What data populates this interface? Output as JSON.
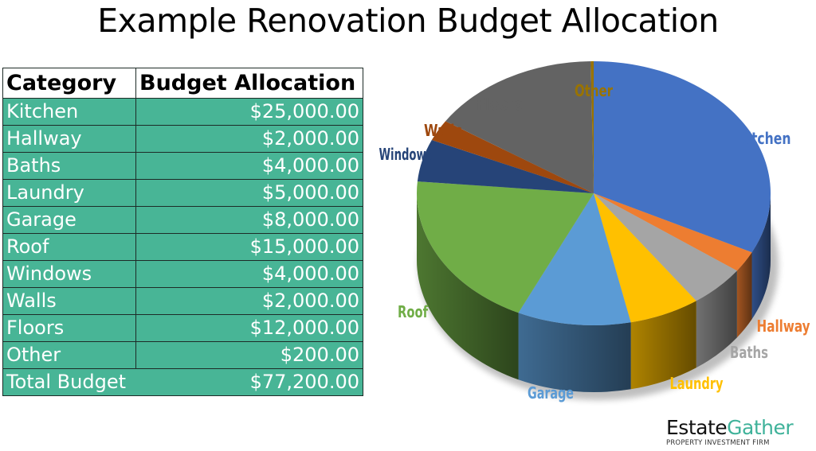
{
  "title": "Example Renovation Budget Allocation",
  "table": {
    "headers": [
      "Category",
      "Budget Allocation"
    ],
    "rows": [
      {
        "category": "Kitchen",
        "value": "$25,000.00"
      },
      {
        "category": "Hallway",
        "value": "$2,000.00"
      },
      {
        "category": "Baths",
        "value": "$4,000.00"
      },
      {
        "category": "Laundry",
        "value": "$5,000.00"
      },
      {
        "category": "Garage",
        "value": "$8,000.00"
      },
      {
        "category": "Roof",
        "value": "$15,000.00"
      },
      {
        "category": "Windows",
        "value": "$4,000.00"
      },
      {
        "category": "Walls",
        "value": "$2,000.00"
      },
      {
        "category": "Floors",
        "value": "$12,000.00"
      },
      {
        "category": "Other",
        "value": "$200.00"
      }
    ],
    "total": {
      "category": "Total Budget",
      "value": "$77,200.00"
    }
  },
  "logo": {
    "name_part1": "Estate",
    "name_part2": "Gather",
    "tagline": "PROPERTY INVESTMENT FIRM"
  },
  "chart_data": {
    "type": "pie",
    "style": "3d",
    "title": "Example Renovation Budget Allocation",
    "categories": [
      "Kitchen",
      "Hallway",
      "Baths",
      "Laundry",
      "Garage",
      "Roof",
      "Windows",
      "Walls",
      "Floors",
      "Other"
    ],
    "values": [
      25000,
      2000,
      4000,
      5000,
      8000,
      15000,
      4000,
      2000,
      12000,
      200
    ],
    "colors": [
      "#4472c4",
      "#ed7d31",
      "#a5a5a5",
      "#ffc000",
      "#5b9bd5",
      "#70ad47",
      "#264478",
      "#9e480e",
      "#636363",
      "#997300"
    ],
    "total": 77200,
    "labels": "category names outside slices, colored to match slice",
    "start": "top, clockwise",
    "legend": "none"
  }
}
